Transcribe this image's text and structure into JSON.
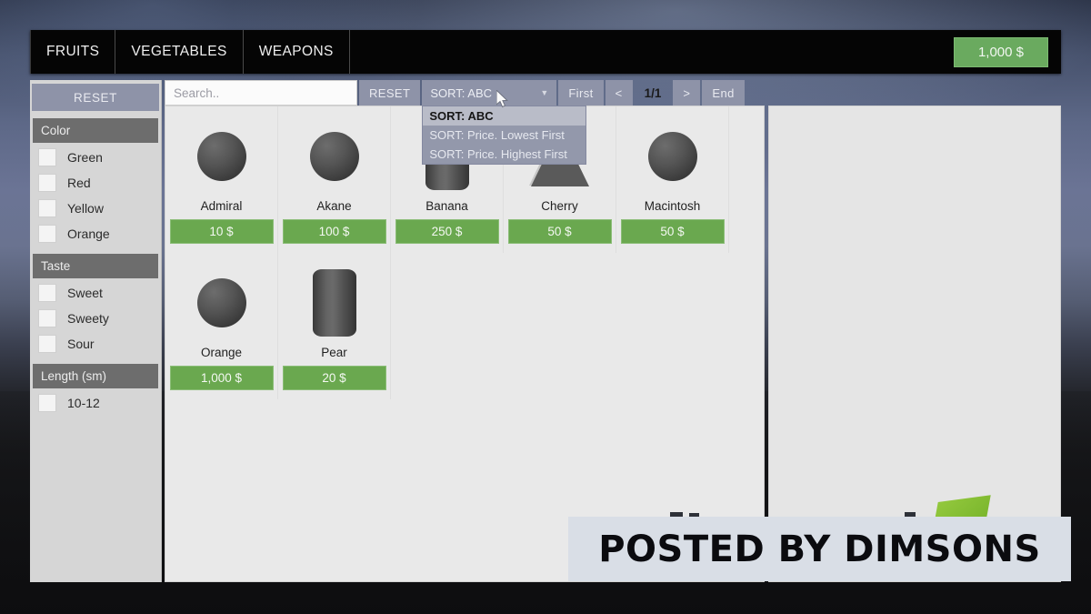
{
  "topbar": {
    "tabs": [
      {
        "label": "FRUITS"
      },
      {
        "label": "VEGETABLES"
      },
      {
        "label": "WEAPONS"
      }
    ],
    "money": "1,000 $",
    "money_color": "#6aaa5f"
  },
  "filters": {
    "reset_label": "RESET",
    "groups": [
      {
        "title": "Color",
        "options": [
          {
            "label": "Green",
            "checked": false
          },
          {
            "label": "Red",
            "checked": false
          },
          {
            "label": "Yellow",
            "checked": false
          },
          {
            "label": "Orange",
            "checked": false
          }
        ]
      },
      {
        "title": "Taste",
        "options": [
          {
            "label": "Sweet",
            "checked": false
          },
          {
            "label": "Sweety",
            "checked": false
          },
          {
            "label": "Sour",
            "checked": false
          }
        ]
      },
      {
        "title": "Length (sm)",
        "options": [
          {
            "label": "10-12",
            "checked": false
          }
        ]
      }
    ]
  },
  "toolbar": {
    "search_placeholder": "Search..",
    "search_value": "",
    "reset_label": "RESET",
    "sort_selected": "SORT: ABC",
    "sort_caret": "▼",
    "sort_options": [
      {
        "label": "SORT: ABC",
        "selected": true
      },
      {
        "label": "SORT: Price. Lowest First",
        "selected": false
      },
      {
        "label": "SORT: Price. Highest First",
        "selected": false
      }
    ],
    "pagination": {
      "first_label": "First",
      "prev_label": "<",
      "page_indicator": "1/1",
      "next_label": ">",
      "end_label": "End"
    }
  },
  "grid": {
    "items": [
      {
        "name": "Admiral",
        "price": "10 $",
        "shape": "sphere"
      },
      {
        "name": "Akane",
        "price": "100 $",
        "shape": "sphere"
      },
      {
        "name": "Banana",
        "price": "250 $",
        "shape": "cylinder"
      },
      {
        "name": "Cherry",
        "price": "50 $",
        "shape": "cone"
      },
      {
        "name": "Macintosh",
        "price": "50 $",
        "shape": "sphere"
      },
      {
        "name": "Orange",
        "price": "1,000 $",
        "shape": "sphere"
      },
      {
        "name": "Pear",
        "price": "20 $",
        "shape": "cylinder"
      }
    ],
    "price_color": "#6aa84f"
  },
  "watermark": {
    "text": "POSTED BY DIMSONS"
  }
}
